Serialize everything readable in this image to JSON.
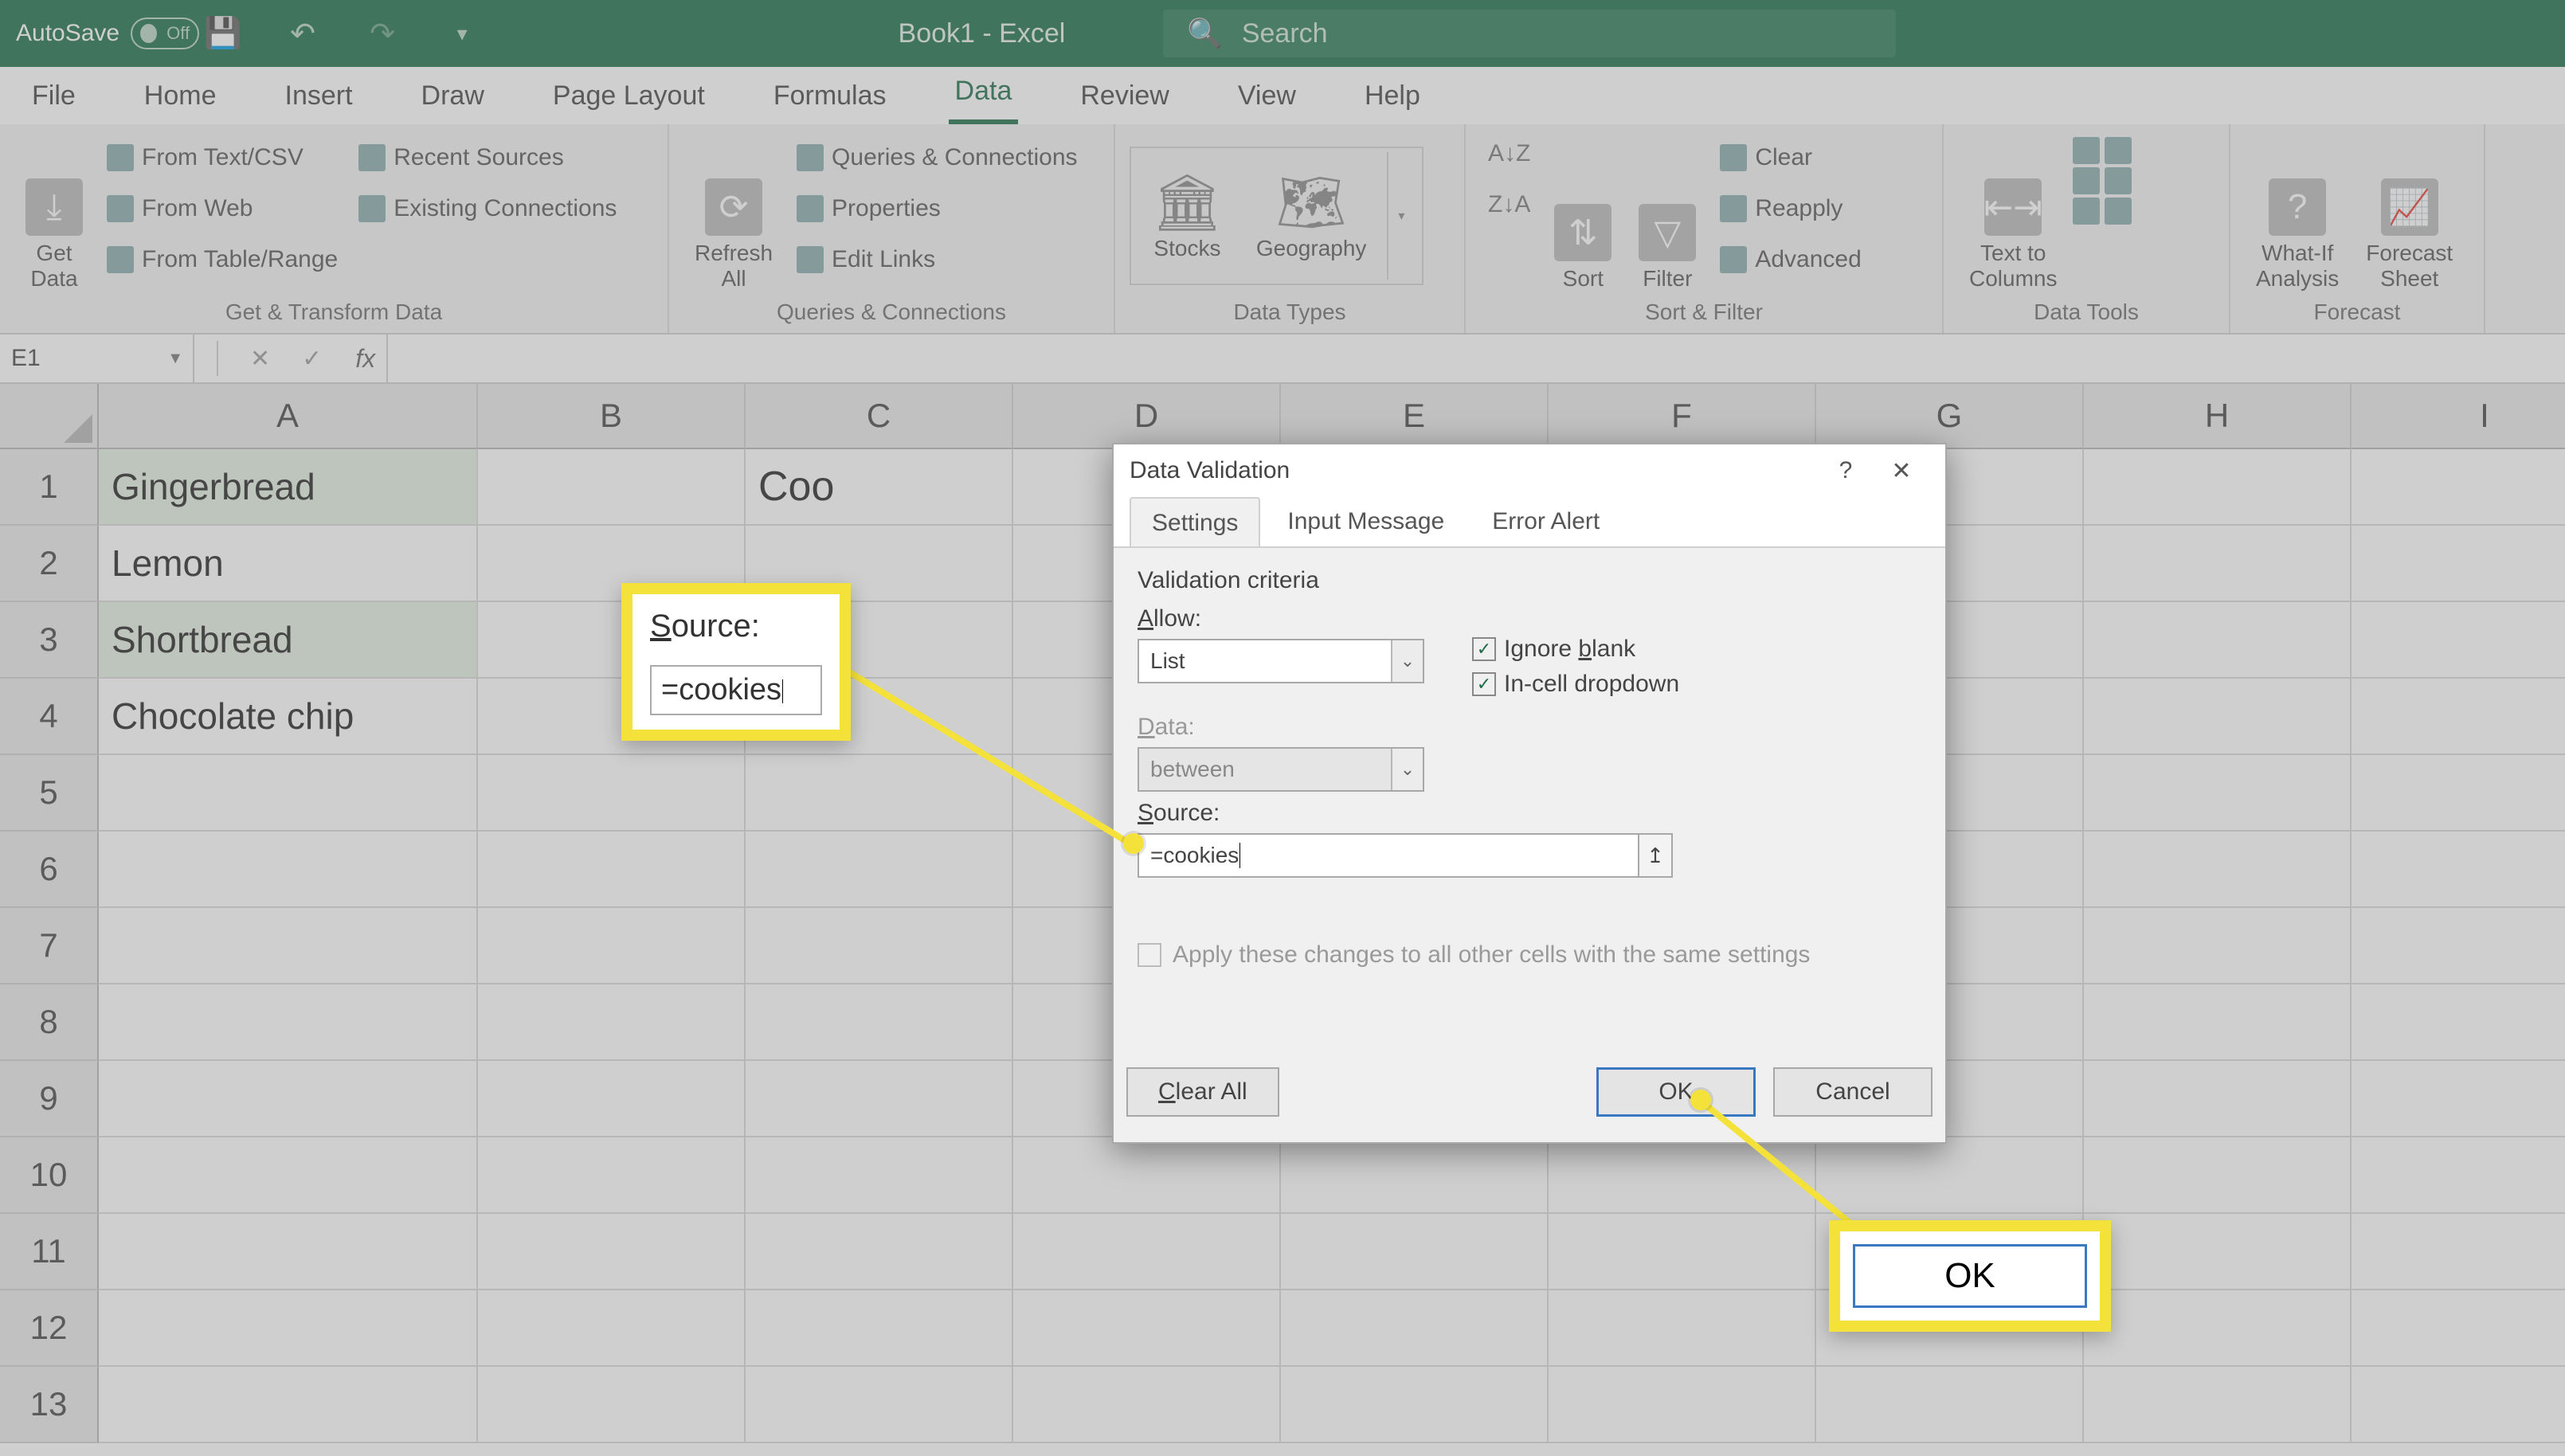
{
  "titlebar": {
    "autosave_label": "AutoSave",
    "autosave_state": "Off",
    "app_title": "Book1  -  Excel",
    "search_placeholder": "Search"
  },
  "tabs": {
    "file": "File",
    "home": "Home",
    "insert": "Insert",
    "draw": "Draw",
    "page_layout": "Page Layout",
    "formulas": "Formulas",
    "data": "Data",
    "review": "Review",
    "view": "View",
    "help": "Help"
  },
  "ribbon": {
    "get_data": "Get\nData",
    "from_text_csv": "From Text/CSV",
    "from_web": "From Web",
    "from_table": "From Table/Range",
    "recent_sources": "Recent Sources",
    "existing_conn": "Existing Connections",
    "grp_get_transform": "Get & Transform Data",
    "refresh_all": "Refresh\nAll",
    "queries_conn": "Queries & Connections",
    "properties": "Properties",
    "edit_links": "Edit Links",
    "grp_queries": "Queries & Connections",
    "stocks": "Stocks",
    "geography": "Geography",
    "grp_datatypes": "Data Types",
    "sort": "Sort",
    "filter": "Filter",
    "clear": "Clear",
    "reapply": "Reapply",
    "advanced": "Advanced",
    "grp_sortfilter": "Sort & Filter",
    "text_to_columns": "Text to\nColumns",
    "grp_datatools": "Data Tools",
    "whatif": "What-If\nAnalysis",
    "forecast_sheet": "Forecast\nSheet",
    "grp_forecast": "Forecast"
  },
  "formula_bar": {
    "namebox": "E1",
    "fx": "fx"
  },
  "grid": {
    "columns": [
      "A",
      "B",
      "C",
      "D",
      "E",
      "F",
      "G",
      "H",
      "I"
    ],
    "rows": [
      "1",
      "2",
      "3",
      "4",
      "5",
      "6",
      "7",
      "8",
      "9",
      "10",
      "11",
      "12",
      "13"
    ],
    "dataA": [
      "Gingerbread",
      "Lemon",
      "Shortbread",
      "Chocolate chip"
    ],
    "c1_partial": "Coo"
  },
  "dialog": {
    "title": "Data Validation",
    "help": "?",
    "close": "✕",
    "tab_settings": "Settings",
    "tab_input_msg": "Input Message",
    "tab_error": "Error Alert",
    "criteria_heading": "Validation criteria",
    "allow_label": "Allow:",
    "allow_value": "List",
    "ignore_blank": "Ignore blank",
    "incell_dd": "In-cell dropdown",
    "data_label": "Data:",
    "data_value": "between",
    "source_label": "Source:",
    "source_value": "=cookies",
    "apply_changes": "Apply these changes to all other cells with the same settings",
    "clear_all": "Clear All",
    "ok": "OK",
    "cancel": "Cancel"
  },
  "callouts": {
    "source_label": "Source:",
    "source_value": "=cookies",
    "ok_label": "OK"
  }
}
